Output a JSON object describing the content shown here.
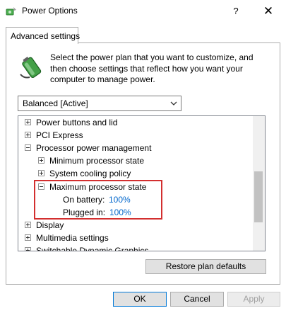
{
  "window": {
    "title": "Power Options",
    "help_glyph": "?",
    "close_glyph": "✕"
  },
  "tabs": [
    {
      "label": "Advanced settings"
    }
  ],
  "description": {
    "lines": [
      "Select the power plan that you want to customize, and",
      "then choose settings that reflect how you want your",
      "computer to manage power."
    ]
  },
  "plan_select": {
    "value": "Balanced [Active]"
  },
  "tree": {
    "power_buttons": "Power buttons and lid",
    "pci_express": "PCI Express",
    "processor_power": "Processor power management",
    "min_state": "Minimum processor state",
    "cooling_policy": "System cooling policy",
    "max_state": "Maximum processor state",
    "on_battery_label": "On battery:",
    "on_battery_value": "100%",
    "plugged_in_label": "Plugged in:",
    "plugged_in_value": "100%",
    "display": "Display",
    "multimedia": "Multimedia settings",
    "switchable_graphics": "Switchable Dynamic Graphics"
  },
  "buttons": {
    "restore": "Restore plan defaults",
    "ok": "OK",
    "cancel": "Cancel",
    "apply": "Apply"
  },
  "colors": {
    "value_link": "#0066cc",
    "highlight_box": "#d32f2f",
    "default_button_border": "#0078d7"
  }
}
